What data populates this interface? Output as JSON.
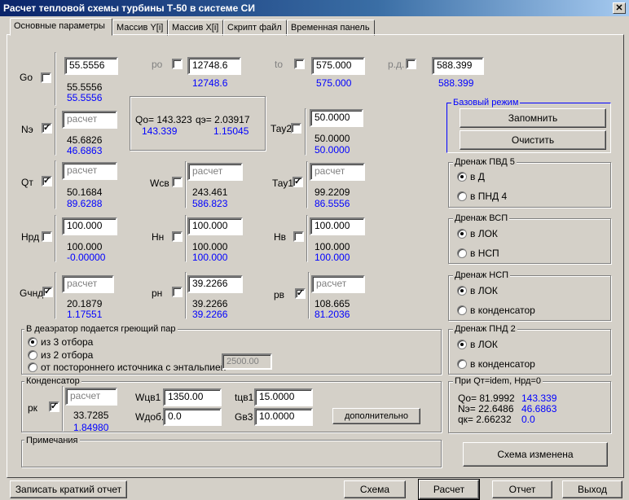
{
  "window": {
    "title": "Расчет тепловой схемы турбины Т-50  в системе СИ",
    "close": "✕"
  },
  "tabs": [
    "Основные параметры",
    "Массив Y[i]",
    "Массив X[i]",
    "Скрипт файл",
    "Временная панель"
  ],
  "params": {
    "go": {
      "label": "Go",
      "input": "55.5556",
      "v1": "55.5556",
      "v2": "55.5556"
    },
    "po": {
      "label": "po",
      "input": "12748.6",
      "v2": "12748.6"
    },
    "to": {
      "label": "to",
      "input": "575.000",
      "v2": "575.000"
    },
    "pd": {
      "label": "р.д.",
      "input": "588.399",
      "v2": "588.399"
    },
    "ne": {
      "label": "Nэ",
      "input": "расчет",
      "v1": "45.6826",
      "v2": "46.6863"
    },
    "qo": {
      "a": "Qo= 143.323",
      "b": "qэ= 2.03917",
      "c": "143.339",
      "d": "1.15045"
    },
    "tau2": {
      "label": "Тау2",
      "input": "50.0000",
      "v1": "50.0000",
      "v2": "50.0000"
    },
    "qt": {
      "label": "Qт",
      "input": "расчет",
      "v1": "50.1684",
      "v2": "89.6288"
    },
    "wsv": {
      "label": "Wсв",
      "input": "расчет",
      "v1": "243.461",
      "v2": "586.823"
    },
    "tau1": {
      "label": "Тау1",
      "input": "расчет",
      "v1": "99.2209",
      "v2": "86.5556"
    },
    "hrd": {
      "label": "Hрд",
      "input": "100.000",
      "v1": "100.000",
      "v2": "-0.00000"
    },
    "hn": {
      "label": "Hн",
      "input": "100.000",
      "v1": "100.000",
      "v2": "100.000"
    },
    "hv": {
      "label": "Hв",
      "input": "100.000",
      "v1": "100.000",
      "v2": "100.000"
    },
    "gchnd": {
      "label": "Gчнд",
      "input": "расчет",
      "v1": "20.1879",
      "v2": "1.17551"
    },
    "pn": {
      "label": "рн",
      "input": "39.2266",
      "v1": "39.2266",
      "v2": "39.2266"
    },
    "pv": {
      "label": "рв",
      "input": "расчет",
      "v1": "108.665",
      "v2": "81.2036"
    }
  },
  "deaerator": {
    "title": "В деаэратор подается греющий пар",
    "opt1": "из 3 отбора",
    "opt2": "из 2 отбора",
    "opt3": "от постороннего источника  с  энтальпией",
    "enthalpy": "2500.00"
  },
  "condenser": {
    "title": "Конденсатор",
    "pk": "рк",
    "input": "расчет",
    "v1": "33.7285",
    "v2": "1.84980",
    "wcv1_label": "Wцв1",
    "wcv1": "1350.00",
    "wdob_label": "Wдоб.",
    "wdob": "0.0",
    "tcv1_label": "tцв1",
    "tcv1": "15.0000",
    "gb3_label": "Gв3",
    "gb3": "10.0000",
    "more": "дополнительно"
  },
  "notes": {
    "title": "Примечания"
  },
  "base": {
    "title": "Базовый режим",
    "remember": "Запомнить",
    "clear": "Очистить"
  },
  "pvd5": {
    "title": "Дренаж ПВД 5",
    "o1": "в Д",
    "o2": "в ПНД 4"
  },
  "vsp": {
    "title": "Дренаж ВСП",
    "o1": "в ЛОК",
    "o2": "в НСП"
  },
  "nsp": {
    "title": "Дренаж НСП",
    "o1": "в ЛОК",
    "o2": "в конденсатор"
  },
  "pnd2": {
    "title": "Дренаж ПНД 2",
    "o1": "в ЛОК",
    "o2": "в конденсатор"
  },
  "qt_idem": {
    "title": "При Qт=idem,     Hрд=0",
    "r1": "Qo= 81.9992",
    "r1b": "143.339",
    "r2": "Nэ= 22.6486",
    "r2b": "46.6863",
    "r3": "qк= 2.66232",
    "r3b": "0.0"
  },
  "schema_changed": "Схема изменена",
  "bottom": {
    "report": "Записать краткий отчет",
    "schema": "Схема",
    "calc": "Расчет",
    "otchet": "Отчет",
    "exit": "Выход"
  }
}
